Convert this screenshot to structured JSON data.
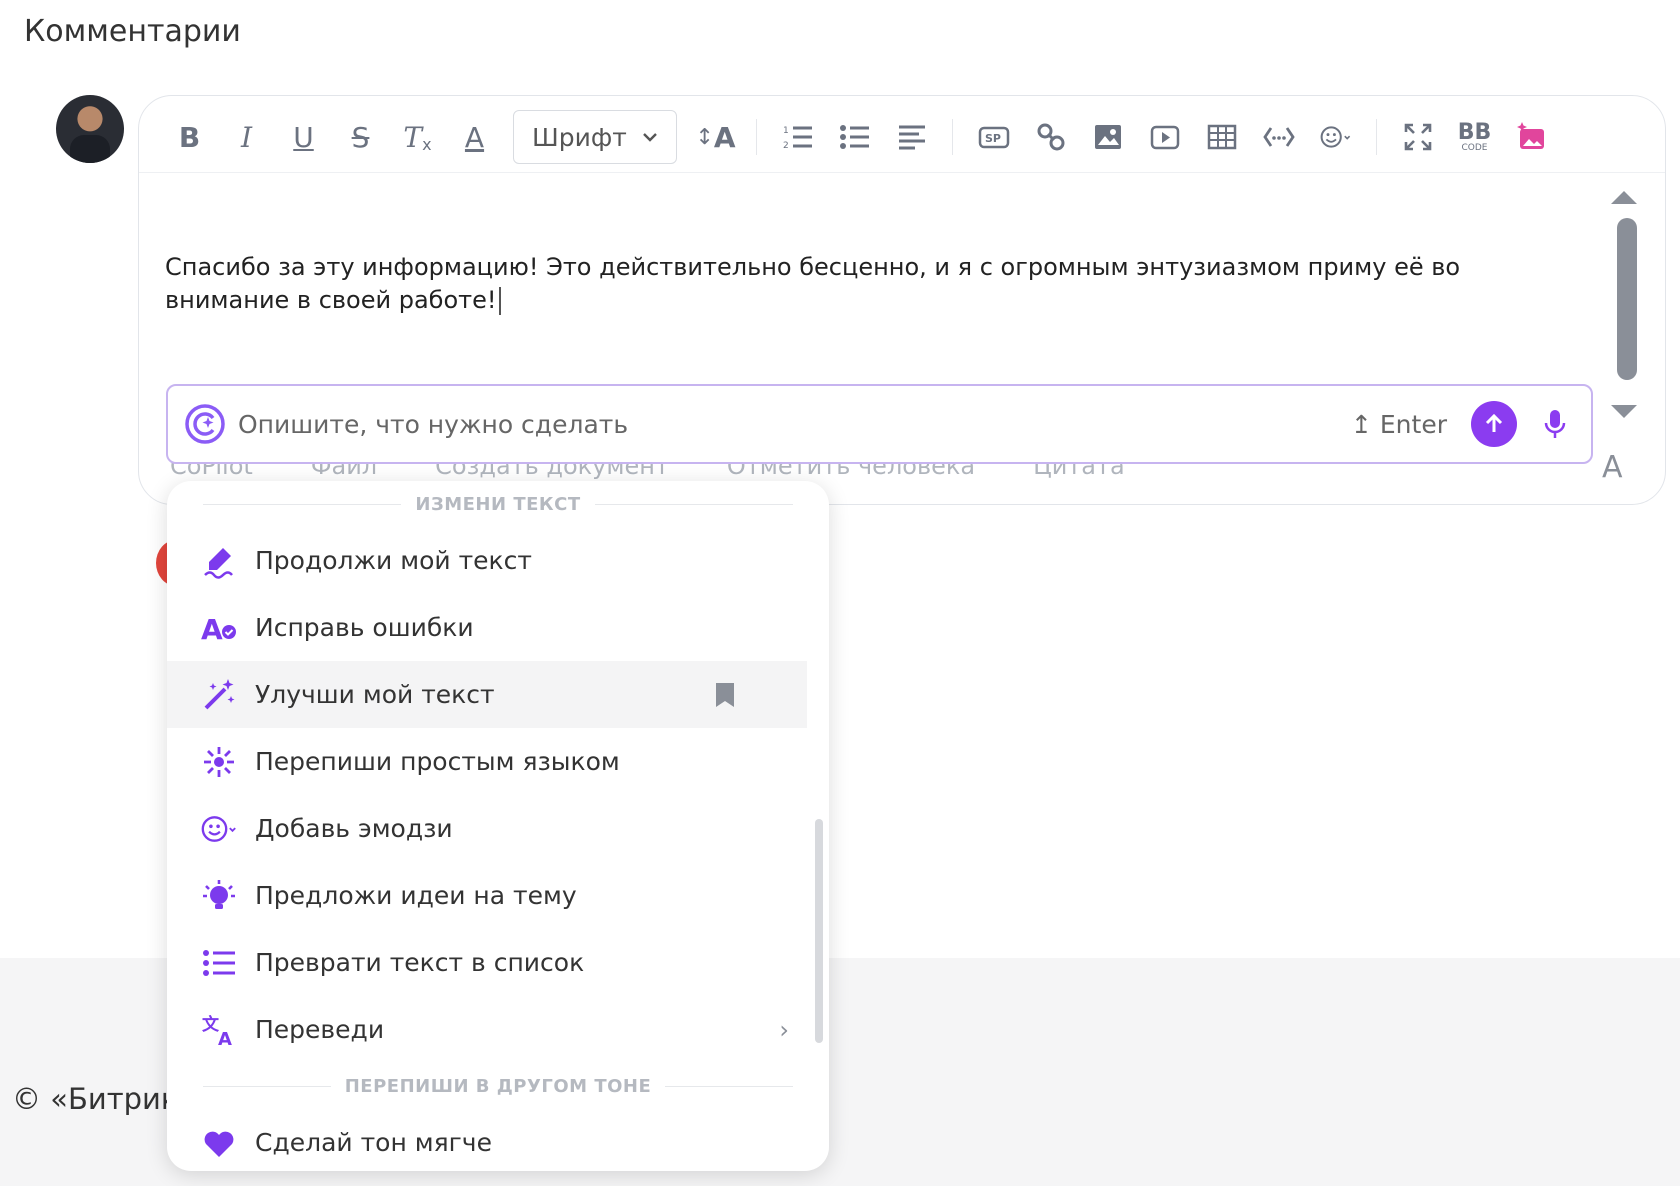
{
  "section_title": "Комментарии",
  "toolbar": {
    "font_select": "Шрифт",
    "bbcode_top": "BB",
    "bbcode_bottom": "CODE"
  },
  "editor": {
    "text": "Спасибо за эту информацию! Это действительно бесценно, и я с огромным энтузиазмом приму её во внимание в своей работе!"
  },
  "copilot": {
    "placeholder": "Опишите, что нужно сделать",
    "enter_hint": "Enter"
  },
  "bottom_links": [
    "CoPilot",
    "Файл",
    "Создать документ",
    "Отметить человека",
    "Цитата"
  ],
  "letter_a": "A",
  "menu": {
    "section1": "ИЗМЕНИ ТЕКСТ",
    "items": [
      {
        "label": "Продолжи мой текст",
        "icon": "pen-scribble-icon"
      },
      {
        "label": "Исправь ошибки",
        "icon": "spellcheck-icon"
      },
      {
        "label": "Улучши мой текст",
        "icon": "magic-wand-icon"
      },
      {
        "label": "Перепиши простым языком",
        "icon": "sparkle-icon"
      },
      {
        "label": "Добавь эмодзи",
        "icon": "emoji-icon"
      },
      {
        "label": "Предложи идеи на тему",
        "icon": "lightbulb-icon"
      },
      {
        "label": "Преврати текст в список",
        "icon": "list-icon"
      },
      {
        "label": "Переведи",
        "icon": "translate-icon"
      }
    ],
    "section2": "ПЕРЕПИШИ В ДРУГОМ ТОНЕ",
    "tone_items": [
      {
        "label": "Сделай тон мягче",
        "icon": "heart-icon"
      }
    ]
  },
  "footer": {
    "copyright": "© «Битрикс"
  }
}
